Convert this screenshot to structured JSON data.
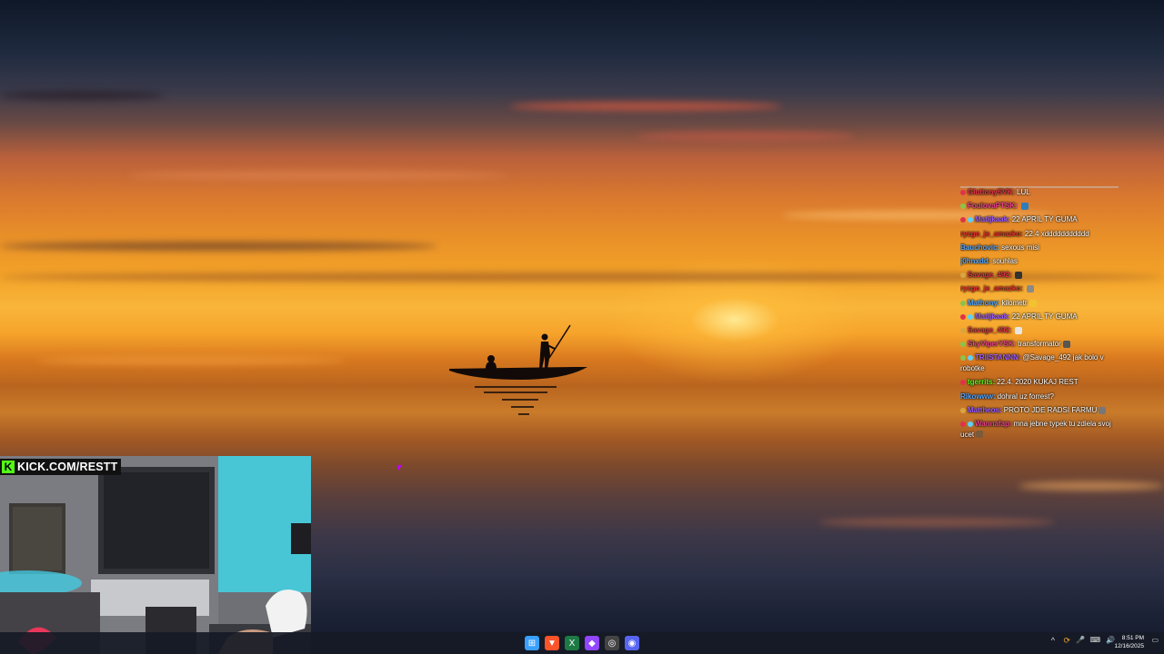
{
  "overlay": {
    "kick_logo": "K",
    "kick_url": "KICK.COM/RESTT"
  },
  "chat": {
    "messages": [
      {
        "user": "GluttonySVK:",
        "text": "LUL",
        "user_color": "#e0334a",
        "badges": [
          "#e0334a"
        ],
        "emote": ""
      },
      {
        "user": "FoulovaPTSK:",
        "text": "",
        "user_color": "#e6428e",
        "badges": [
          "#8bc34a"
        ],
        "emote": "#2e7dbb"
      },
      {
        "user": "Matijkaak:",
        "text": "22 APRIL TY GUMA",
        "user_color": "#9b5cff",
        "badges": [
          "#e0334a",
          "#5ad1ff"
        ],
        "emote": ""
      },
      {
        "user": "ryzgo_je_amazko:",
        "text": "22.4 xddddddddddd",
        "user_color": "#e8302e",
        "badges": [],
        "emote": ""
      },
      {
        "user": "Bauchovic:",
        "text": "sexous misi",
        "user_color": "#4fa3ff",
        "badges": [],
        "emote": ""
      },
      {
        "user": "j0hnxdd:",
        "text": "souhlas",
        "user_color": "#4fa3ff",
        "badges": [],
        "emote": ""
      },
      {
        "user": "Savage_492:",
        "text": "",
        "user_color": "#e0334a",
        "badges": [
          "#d8a640"
        ],
        "emote": "#333333"
      },
      {
        "user": "ryzgo_je_amazko:",
        "text": "",
        "user_color": "#e8302e",
        "badges": [],
        "emote": "#8a8a8a"
      },
      {
        "user": "Mathony:",
        "text": "kilometr",
        "user_color": "#4fa3ff",
        "badges": [
          "#8bc34a"
        ],
        "emote": "#f2c230"
      },
      {
        "user": "Matijkaak:",
        "text": "22 APRIL TY GUMA",
        "user_color": "#9b5cff",
        "badges": [
          "#e0334a",
          "#5ad1ff"
        ],
        "emote": ""
      },
      {
        "user": "Savage_492:",
        "text": "",
        "user_color": "#e0334a",
        "badges": [
          "#d8a640"
        ],
        "emote": "#e6e6e6"
      },
      {
        "user": "SkyViperYSK:",
        "text": "transformator",
        "user_color": "#e6428e",
        "badges": [
          "#8bc34a"
        ],
        "emote": "#555555"
      },
      {
        "user": "TRIISTANNN:",
        "text": "@Savage_492 jak bolo v robotke",
        "user_color": "#9b5cff",
        "badges": [
          "#8bc34a",
          "#5ad1ff"
        ],
        "emote": "",
        "wrap": true
      },
      {
        "user": "tgerrits:",
        "text": "22.4. 2020 KUKAJ REST",
        "user_color": "#53fc18",
        "badges": [
          "#e0334a"
        ],
        "emote": ""
      },
      {
        "user": "Rikowww:",
        "text": "dohral uz forrest?",
        "user_color": "#4fa3ff",
        "badges": [],
        "emote": ""
      },
      {
        "user": "Mattheos:",
        "text": "PROTO JDE RADSI FARMU",
        "user_color": "#9b5cff",
        "badges": [
          "#d8a640"
        ],
        "emote": "#777777"
      },
      {
        "user": "Wannafap:",
        "text": "mna jebne typek tu zdiela svoj ucet",
        "user_color": "#e6428e",
        "badges": [
          "#e0334a",
          "#5ad1ff"
        ],
        "emote": "#7a5a3a",
        "wrap": true
      }
    ]
  },
  "taskbar": {
    "icons": [
      {
        "name": "windows-start-icon",
        "color": "#3aa0ff",
        "glyph": "⊞"
      },
      {
        "name": "brave-browser-icon",
        "color": "#fb542b",
        "glyph": "▼"
      },
      {
        "name": "excel-icon",
        "color": "#1d7a45",
        "glyph": "X"
      },
      {
        "name": "twitch-icon",
        "color": "#9146ff",
        "glyph": "◆"
      },
      {
        "name": "obs-icon",
        "color": "#444444",
        "glyph": "◎"
      },
      {
        "name": "discord-icon",
        "color": "#5865f2",
        "glyph": "◉"
      }
    ],
    "tray": [
      "^",
      "⟳",
      "🎤",
      "⌨",
      "🔊"
    ],
    "time": "8:51 PM",
    "date": "12/16/2025"
  }
}
